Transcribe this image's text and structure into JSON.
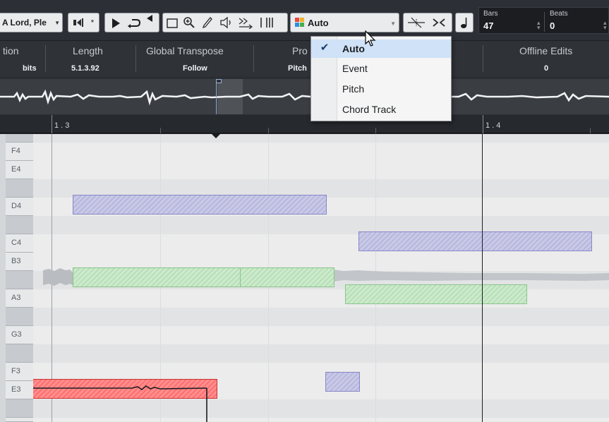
{
  "toolbar": {
    "track_select": "A Lord, Ple",
    "mode_select": {
      "value": "Auto"
    },
    "position": {
      "bars_label": "Bars",
      "bars_value": "47",
      "beats_label": "Beats",
      "beats_value": "0"
    }
  },
  "infoline": {
    "columns": [
      {
        "label": "tion",
        "value": "bits"
      },
      {
        "label": "Length",
        "value": "5.1.3.92"
      },
      {
        "label": "Global Transpose",
        "value": "Follow"
      },
      {
        "label": "Pro",
        "value": "Pitch"
      },
      {
        "label": "Offline Edits",
        "value": "0"
      }
    ]
  },
  "ruler": {
    "markers": [
      "1 . 3",
      "1 . 4"
    ]
  },
  "keyboard": {
    "labels": [
      "F4",
      "E4",
      "D4",
      "C4",
      "B3",
      "A3",
      "G3",
      "F3",
      "E3"
    ]
  },
  "dropdown_menu": {
    "items": [
      {
        "label": "Auto",
        "checked": true
      },
      {
        "label": "Event",
        "checked": false
      },
      {
        "label": "Pitch",
        "checked": false
      },
      {
        "label": "Chord Track",
        "checked": false
      }
    ],
    "check_glyph": "✔"
  },
  "icons": [
    "dropdown-arrow-icon",
    "snap-icon",
    "play-icon",
    "loop-icon",
    "object-select-icon",
    "zoom-icon",
    "draw-icon",
    "speaker-icon",
    "quantize-icon",
    "segment-icon",
    "mode-color-icon",
    "trim-icon",
    "straighten-icon",
    "note-icon",
    "checkmark-icon",
    "mouse-cursor-icon"
  ],
  "colors": {
    "blue_segment": "#c9c9e8",
    "green_segment": "#cdeacd",
    "red_segment": "#ff8f8f",
    "menu_highlight": "#cfe2f7"
  }
}
